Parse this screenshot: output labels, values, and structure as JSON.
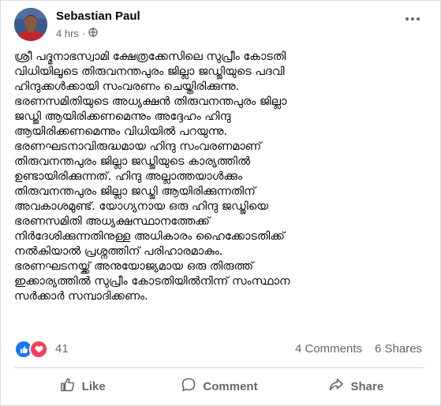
{
  "post": {
    "author": "Sebastian Paul",
    "timestamp": "4 hrs",
    "separator": "·",
    "audience_icon": "globe-icon",
    "body_lines": [
      "ശ്രീ പദ്മനാഭസ്വാമി ക്ഷേത്രക്കേസിലെ സുപ്രീം കോടതി",
      "വിധിയിലൂടെ തിരുവനന്തപുരം ജില്ലാ ജഡ്ജിയുടെ പദവി",
      "ഹിന്ദുക്കൾക്കായി സംവരണം ചെയ്തിരിക്കുന്നു.",
      "ഭരണസമിതിയുടെ അധ്യക്ഷൻ തിരുവനന്തപുരം ജില്ലാ",
      "ജഡ്ജി ആയിരിക്കണമെന്നും അദ്ദേഹം ഹിന്ദു",
      "ആയിരിക്കണമെന്നും വിധിയിൽ പറയുന്നു.",
      "ഭരണഘടനാവിരുദ്ധമായ ഹിന്ദു സംവരണമാണ്",
      "തിരുവനന്തപുരം ജില്ലാ ജഡ്ജിയുടെ കാര്യത്തിൽ",
      "ഉണ്ടായിരിക്കുന്നത്. ഹിന്ദു അല്ലാത്തയാൾക്കും",
      "തിരുവനന്തപുരം ജില്ലാ ജഡ്ജി ആയിരിക്കുന്നതിന്",
      "അവകാശമുണ്ട്. യോഗ്യനായ ഒരു ഹിന്ദു ജഡ്ജിയെ",
      "ഭരണസമിതി അധ്യക്ഷസ്ഥാനത്തേക്ക്",
      "നിർദേശിക്കുന്നതിനുള്ള അധികാരം ഹൈക്കോടതിക്ക്",
      "നൽകിയാൽ പ്രശ്നത്തിന് പരിഹാരമാകും.",
      "ഭരണഘടനയ്ക്ക് അനുയോജ്യമായ ഒരു തിരുത്ത്",
      "ഇക്കാര്യത്തിൽ സുപ്രീം കോടതിയിൽനിന്ന് സംസ്ഥാന",
      "സർക്കാർ സമ്പാദിക്കണം."
    ]
  },
  "reactions": {
    "types": [
      "like",
      "love"
    ],
    "count": "41",
    "comments": "4 Comments",
    "shares": "6 Shares"
  },
  "actions": {
    "like": "Like",
    "comment": "Comment",
    "share": "Share"
  },
  "colors": {
    "like_blue": "#1877f2",
    "love_red": "#f33e58",
    "muted_text": "#65676b",
    "divider": "#ced0d4"
  }
}
